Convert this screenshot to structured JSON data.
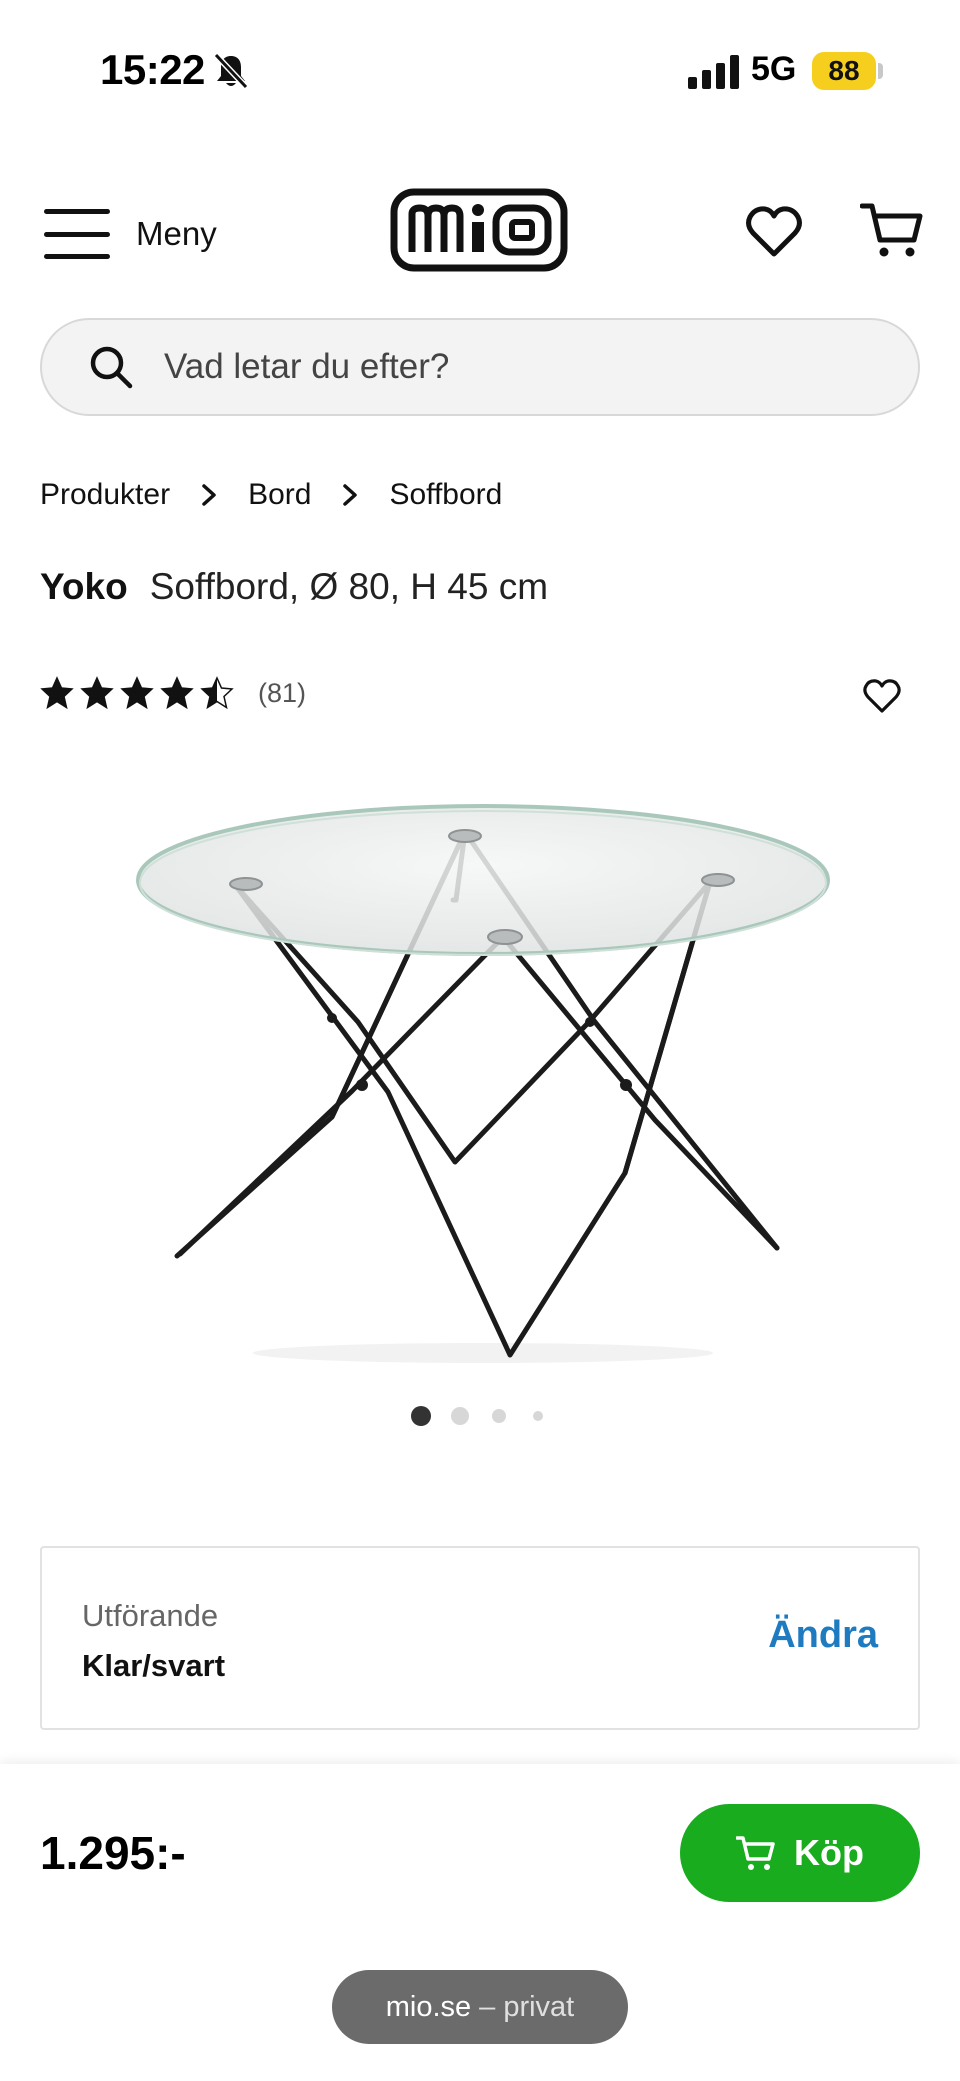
{
  "status_bar": {
    "time": "15:22",
    "network": "5G",
    "battery": "88",
    "battery_color": "#f6cf1e"
  },
  "header": {
    "menu_label": "Meny",
    "logo_text": "mio"
  },
  "search": {
    "placeholder": "Vad letar du efter?"
  },
  "breadcrumb": [
    "Produkter",
    "Bord",
    "Soffbord"
  ],
  "product": {
    "brand": "Yoko",
    "description": "Soffbord, Ø 80, H 45 cm",
    "rating": 4.5,
    "review_count": "(81)",
    "image_alt": "Yoko soffbord med glasskiva och svarta metallben"
  },
  "carousel": {
    "total": 4,
    "active": 1
  },
  "variant": {
    "label": "Utförande",
    "value": "Klar/svart",
    "change_label": "Ändra"
  },
  "buy_bar": {
    "price": "1.295:-",
    "buy_label": "Köp",
    "accent_color": "#18ac1e"
  },
  "browser": {
    "domain": "mio.se",
    "separator": "–",
    "mode": "privat"
  }
}
